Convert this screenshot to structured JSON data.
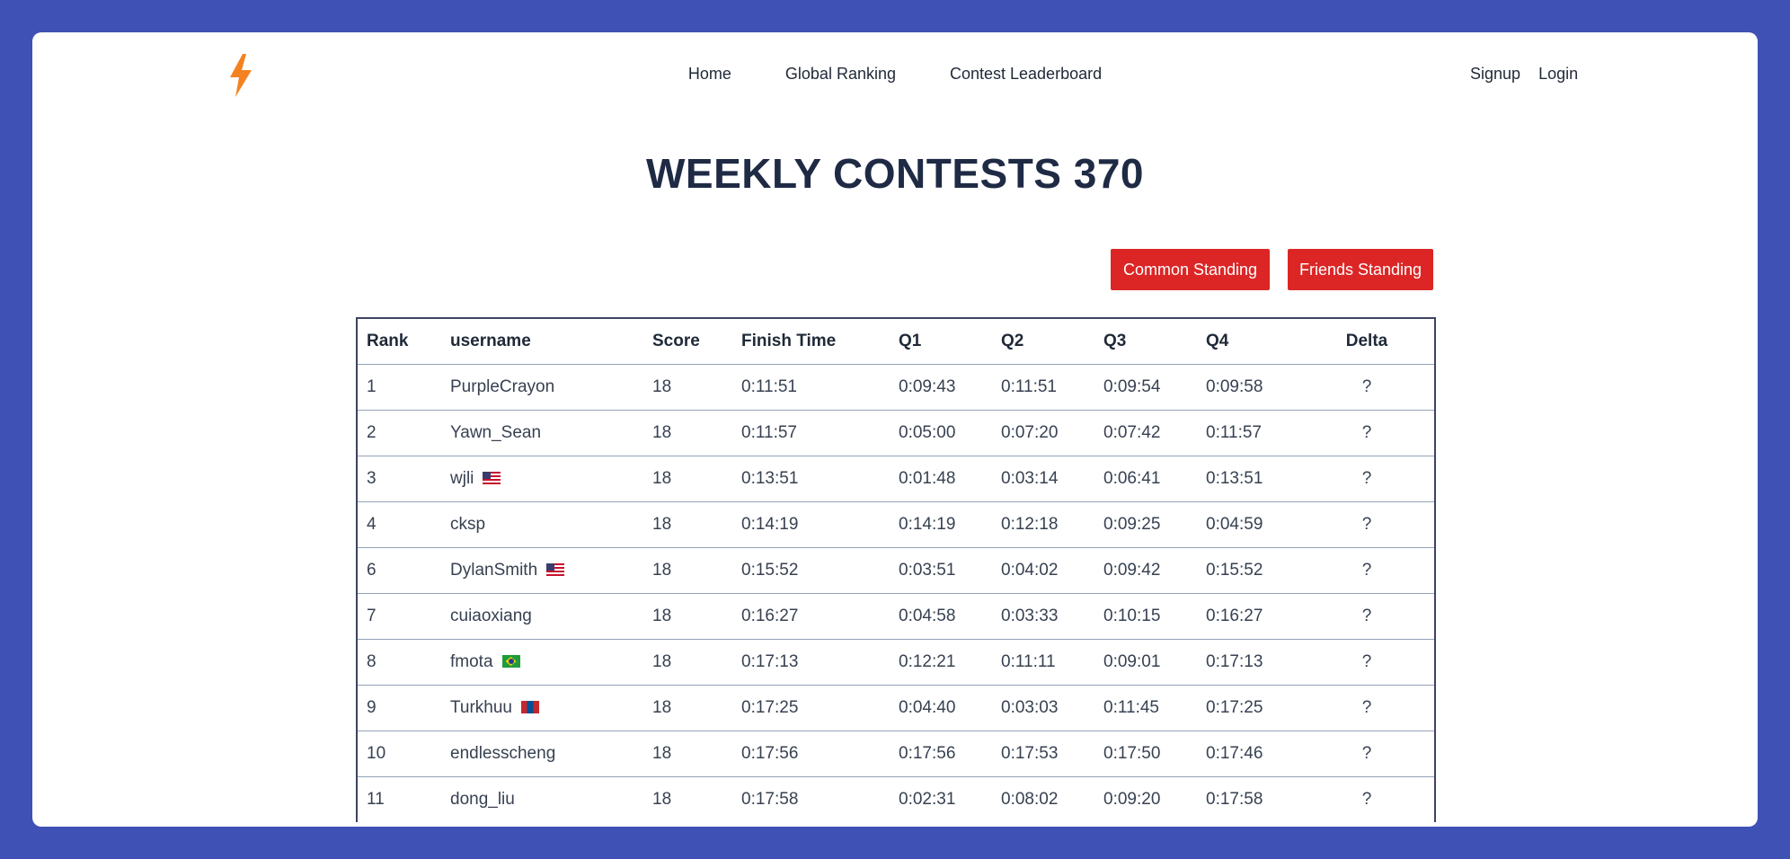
{
  "nav": {
    "items": [
      {
        "label": "Home"
      },
      {
        "label": "Global Ranking"
      },
      {
        "label": "Contest Leaderboard"
      }
    ],
    "auth": {
      "signup": "Signup",
      "login": "Login"
    },
    "logo_icon": "lightning-bolt-icon",
    "logo_color": "#f58220"
  },
  "page": {
    "title": "WEEKLY CONTESTS 370",
    "buttons": {
      "common": "Common Standing",
      "friends": "Friends Standing"
    },
    "button_color": "#dc2626"
  },
  "table": {
    "headers": [
      "Rank",
      "username",
      "Score",
      "Finish Time",
      "Q1",
      "Q2",
      "Q3",
      "Q4",
      "Delta"
    ],
    "rows": [
      {
        "rank": "1",
        "username": "PurpleCrayon",
        "flag": "",
        "score": "18",
        "finish": "0:11:51",
        "q1": "0:09:43",
        "q2": "0:11:51",
        "q3": "0:09:54",
        "q4": "0:09:58",
        "delta": "?"
      },
      {
        "rank": "2",
        "username": "Yawn_Sean",
        "flag": "",
        "score": "18",
        "finish": "0:11:57",
        "q1": "0:05:00",
        "q2": "0:07:20",
        "q3": "0:07:42",
        "q4": "0:11:57",
        "delta": "?"
      },
      {
        "rank": "3",
        "username": "wjli",
        "flag": "us-flag-icon",
        "score": "18",
        "finish": "0:13:51",
        "q1": "0:01:48",
        "q2": "0:03:14",
        "q3": "0:06:41",
        "q4": "0:13:51",
        "delta": "?"
      },
      {
        "rank": "4",
        "username": "cksp",
        "flag": "",
        "score": "18",
        "finish": "0:14:19",
        "q1": "0:14:19",
        "q2": "0:12:18",
        "q3": "0:09:25",
        "q4": "0:04:59",
        "delta": "?"
      },
      {
        "rank": "6",
        "username": "DylanSmith",
        "flag": "us-flag-icon",
        "score": "18",
        "finish": "0:15:52",
        "q1": "0:03:51",
        "q2": "0:04:02",
        "q3": "0:09:42",
        "q4": "0:15:52",
        "delta": "?"
      },
      {
        "rank": "7",
        "username": "cuiaoxiang",
        "flag": "",
        "score": "18",
        "finish": "0:16:27",
        "q1": "0:04:58",
        "q2": "0:03:33",
        "q3": "0:10:15",
        "q4": "0:16:27",
        "delta": "?"
      },
      {
        "rank": "8",
        "username": "fmota",
        "flag": "br-flag-icon",
        "score": "18",
        "finish": "0:17:13",
        "q1": "0:12:21",
        "q2": "0:11:11",
        "q3": "0:09:01",
        "q4": "0:17:13",
        "delta": "?"
      },
      {
        "rank": "9",
        "username": "Turkhuu",
        "flag": "mn-flag-icon",
        "score": "18",
        "finish": "0:17:25",
        "q1": "0:04:40",
        "q2": "0:03:03",
        "q3": "0:11:45",
        "q4": "0:17:25",
        "delta": "?"
      },
      {
        "rank": "10",
        "username": "endlesscheng",
        "flag": "",
        "score": "18",
        "finish": "0:17:56",
        "q1": "0:17:56",
        "q2": "0:17:53",
        "q3": "0:17:50",
        "q4": "0:17:46",
        "delta": "?"
      },
      {
        "rank": "11",
        "username": "dong_liu",
        "flag": "",
        "score": "18",
        "finish": "0:17:58",
        "q1": "0:02:31",
        "q2": "0:08:02",
        "q3": "0:09:20",
        "q4": "0:17:58",
        "delta": "?"
      }
    ]
  }
}
